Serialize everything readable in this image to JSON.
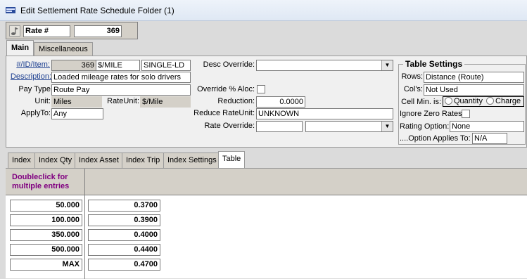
{
  "window": {
    "title": "Edit Settlement Rate Schedule Folder (1)"
  },
  "header": {
    "rate_label": "Rate #",
    "rate_value": "369"
  },
  "tabs": [
    {
      "label": "Main"
    },
    {
      "label": "Miscellaneous"
    }
  ],
  "main": {
    "id_label": "#/ID/Item:",
    "id_value": "369",
    "id_unit": "$/MILE",
    "id_item": "SINGLE-LD",
    "description_label": "Description:",
    "description_value": "Loaded mileage rates for solo drivers",
    "pay_type_label": "Pay Type",
    "pay_type_value": "Route Pay",
    "unit_label": "Unit:",
    "unit_value": "Miles",
    "rate_unit_label": "RateUnit:",
    "rate_unit_value": "$/Mile",
    "apply_to_label": "ApplyTo:",
    "apply_to_value": "Any",
    "desc_override_label": "Desc Override:",
    "desc_override_value": "",
    "override_aloc_label": "Override % Aloc:",
    "reduction_label": "Reduction:",
    "reduction_value": "0.0000",
    "reduce_rate_unit_label": "Reduce RateUnit:",
    "reduce_rate_unit_value": "UNKNOWN",
    "rate_override_label": "Rate Override:",
    "rate_override_value": "",
    "rate_override_select": ""
  },
  "table_settings": {
    "legend": "Table Settings",
    "rows_label": "Rows:",
    "rows_value": "Distance (Route)",
    "cols_label": "Col's:",
    "cols_value": "Not Used",
    "cell_min_label": "Cell Min. is:",
    "cell_min_options": [
      "Quantity",
      "Charge"
    ],
    "ignore_zero_label": "Ignore Zero Rates",
    "rating_option_label": "Rating Option:",
    "rating_option_value": "None",
    "option_applies_label": "....Option Applies To:",
    "option_applies_value": "N/A"
  },
  "lower_tabs": [
    {
      "label": "Index"
    },
    {
      "label": "Index Qty"
    },
    {
      "label": "Index Asset"
    },
    {
      "label": "Index Trip"
    },
    {
      "label": "Index Settings"
    },
    {
      "label": "Table"
    }
  ],
  "rate_table": {
    "header": "Doubleclick for multiple entries",
    "rows": [
      {
        "range": "50.000",
        "rate": "0.3700"
      },
      {
        "range": "100.000",
        "rate": "0.3900"
      },
      {
        "range": "350.000",
        "rate": "0.4000"
      },
      {
        "range": "500.000",
        "rate": "0.4400"
      },
      {
        "range": "MAX",
        "rate": "0.4700"
      }
    ]
  },
  "colors": {
    "header_text": "#800080",
    "panel": "#f0f0f0",
    "titlebar": "#dfe8f4"
  }
}
